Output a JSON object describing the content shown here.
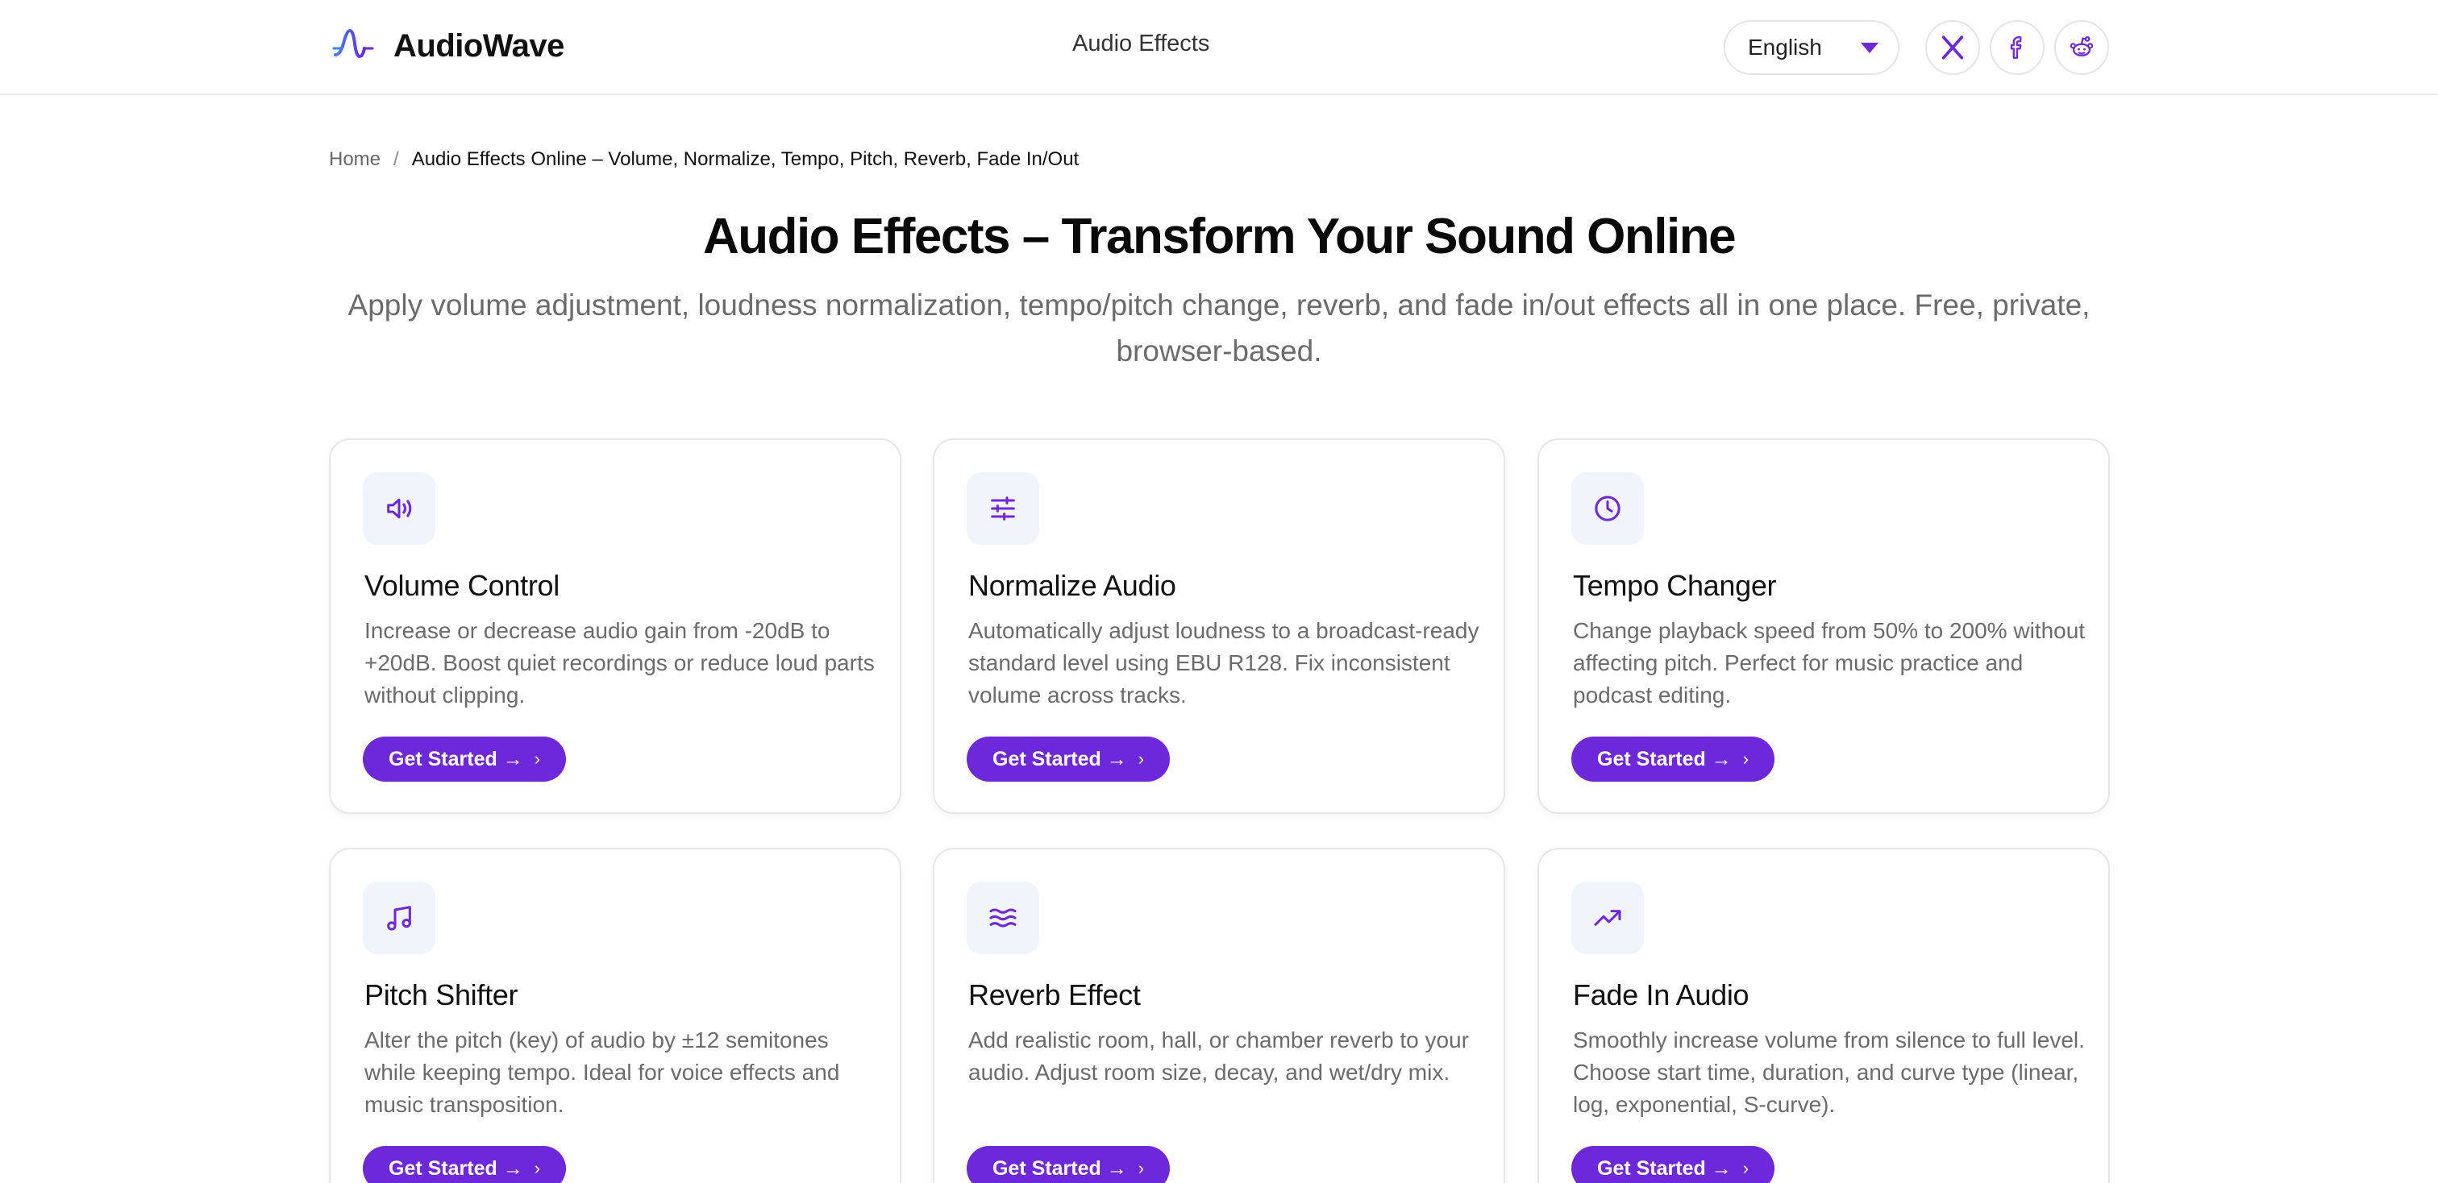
{
  "header": {
    "brand": "AudioWave",
    "nav_link": "Audio Effects",
    "language": "English",
    "social": [
      "x-icon",
      "facebook-icon",
      "reddit-icon"
    ]
  },
  "breadcrumb": {
    "home": "Home",
    "separator": "/",
    "current": "Audio Effects Online – Volume, Normalize, Tempo, Pitch, Reverb, Fade In/Out"
  },
  "hero": {
    "title": "Audio Effects – Transform Your Sound Online",
    "subtitle": "Apply volume adjustment, loudness normalization, tempo/pitch change, reverb, and fade in/out effects all in one place. Free, private, browser-based."
  },
  "cards": [
    {
      "icon": "speaker-icon",
      "title": "Volume Control",
      "description": "Increase or decrease audio gain from -20dB to +20dB. Boost quiet recordings or reduce loud parts without clipping.",
      "button": "Get Started →"
    },
    {
      "icon": "sliders-icon",
      "title": "Normalize Audio",
      "description": "Automatically adjust loudness to a broadcast-ready standard level using EBU R128. Fix inconsistent volume across tracks.",
      "button": "Get Started →"
    },
    {
      "icon": "clock-icon",
      "title": "Tempo Changer",
      "description": "Change playback speed from 50% to 200% without affecting pitch. Perfect for music practice and podcast editing.",
      "button": "Get Started →"
    },
    {
      "icon": "music-note-icon",
      "title": "Pitch Shifter",
      "description": "Alter the pitch (key) of audio by ±12 semitones while keeping tempo. Ideal for voice effects and music transposition.",
      "button": "Get Started →"
    },
    {
      "icon": "waves-icon",
      "title": "Reverb Effect",
      "description": "Add realistic room, hall, or chamber reverb to your audio. Adjust room size, decay, and wet/dry mix.",
      "button": "Get Started →"
    },
    {
      "icon": "trending-up-icon",
      "title": "Fade In Audio",
      "description": "Smoothly increase volume from silence to full level. Choose start time, duration, and curve type (linear, log, exponential, S-curve).",
      "button": "Get Started →"
    }
  ],
  "colors": {
    "accent": "#6d28d9",
    "icon_bg": "#f1f4fb",
    "muted_text": "#6b6b6b",
    "border": "#e6e6e6"
  }
}
